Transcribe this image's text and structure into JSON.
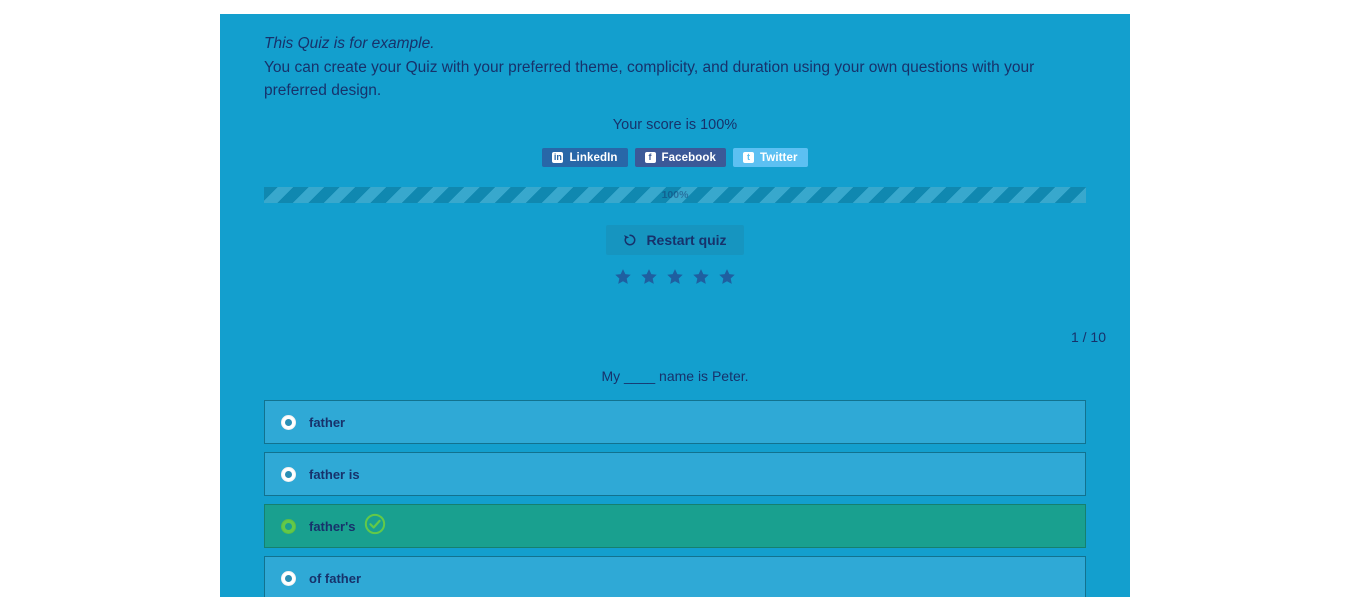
{
  "intro": {
    "italic_line": "This Quiz is for example.",
    "body": "You can create your Quiz with your preferred theme, complicity, and duration using your own questions with your preferred design."
  },
  "score": {
    "text": "Your score is 100%",
    "value": 100
  },
  "share": {
    "buttons": [
      {
        "label": "LinkedIn",
        "icon": "linkedin-icon",
        "glyph": "in",
        "color": "#2867a8"
      },
      {
        "label": "Facebook",
        "icon": "facebook-icon",
        "glyph": "f",
        "color": "#3b5998"
      },
      {
        "label": "Twitter",
        "icon": "twitter-icon",
        "glyph": "t",
        "color": "#5cc0f2"
      }
    ]
  },
  "progress": {
    "label": "100%",
    "percent": 100,
    "fill_color": "#1297c4",
    "track_color": "#1aa3cf"
  },
  "restart": {
    "label": "Restart quiz",
    "icon": "restart-arrow-icon"
  },
  "rating": {
    "stars_total": 5,
    "stars_filled": 5,
    "star_color": "#1f5fa0"
  },
  "question": {
    "counter": "1 / 10",
    "text": "My ____ name is Peter.",
    "options": [
      {
        "label": "father",
        "correct": false
      },
      {
        "label": "father is",
        "correct": false
      },
      {
        "label": "father's",
        "correct": true
      },
      {
        "label": "of father",
        "correct": false
      }
    ]
  },
  "theme": {
    "page_background": "#ffffff",
    "container_background": "#139fce",
    "text_color": "#17326b",
    "option_background": "#2fa9d6",
    "option_border": "#12728f",
    "correct_background": "#19a08f",
    "correct_accent": "#63c948"
  }
}
